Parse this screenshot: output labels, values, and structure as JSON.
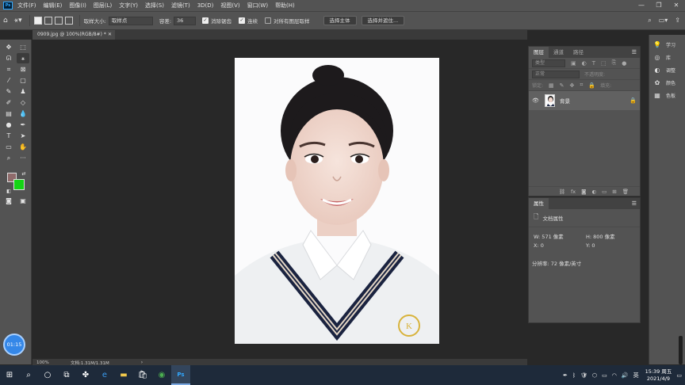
{
  "app": {
    "logo": "Ps"
  },
  "menu": [
    "文件(F)",
    "编辑(E)",
    "图像(I)",
    "图层(L)",
    "文字(Y)",
    "选择(S)",
    "滤镜(T)",
    "3D(D)",
    "视图(V)",
    "窗口(W)",
    "帮助(H)"
  ],
  "window_controls": {
    "minimize": "—",
    "restore": "❐",
    "close": "✕"
  },
  "options_bar": {
    "sample_size_label": "取样大小:",
    "sample_size_value": "取样点",
    "tolerance_label": "容差:",
    "tolerance_value": "36",
    "antialias_label": "消除锯齿",
    "antialias_checked": true,
    "contiguous_label": "连续",
    "contiguous_checked": true,
    "sample_all_label": "对所有图层取样",
    "sample_all_checked": false,
    "select_subject_label": "选择主体",
    "select_mask_label": "选择并遮住..."
  },
  "document": {
    "tab_title": "0909.jpg @ 100%(RGB/8#) *",
    "zoom": "100%",
    "doc_size": "文档:1.31M/1.31M",
    "status_arrow": "›"
  },
  "colors": {
    "foreground": "#8f6b6b",
    "background": "#14d414",
    "accent": "#31a8ff"
  },
  "timer": "01:15",
  "layers_panel": {
    "tabs": [
      "图层",
      "通道",
      "路径"
    ],
    "filter_placeholder": "类型",
    "blend_mode": "正常",
    "opacity_label": "不透明度:",
    "lock_label": "锁定:",
    "fill_label": "填充:",
    "layer_name": "背景"
  },
  "properties_panel": {
    "title": "属性",
    "section": "文档属性",
    "w": "W:  571 像素",
    "h": "H:  800 像素",
    "x": "X:  0",
    "y": "Y:  0",
    "resolution": "分辨率: 72 像素/英寸"
  },
  "dock": [
    "学习",
    "库",
    "调整",
    "颜色",
    "色板"
  ],
  "taskbar": {
    "ime": "英",
    "time": "15:39 周五",
    "date": "2021/4/9"
  }
}
